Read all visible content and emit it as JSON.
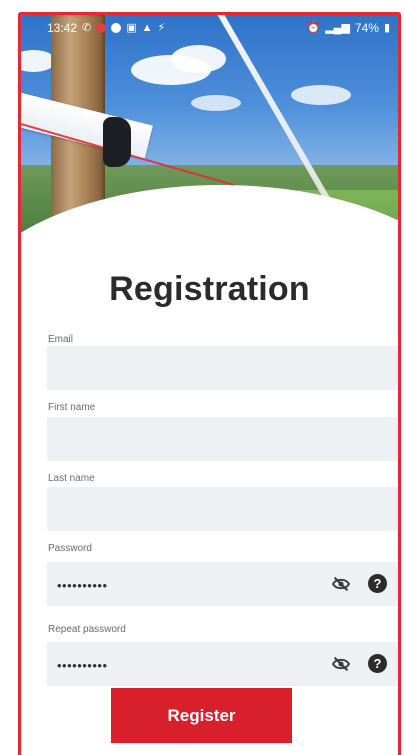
{
  "status_bar": {
    "time": "13:42",
    "battery": "74%"
  },
  "page": {
    "title": "Registration"
  },
  "form": {
    "email": {
      "label": "Email",
      "value": ""
    },
    "first_name": {
      "label": "First name",
      "value": ""
    },
    "last_name": {
      "label": "Last name",
      "value": ""
    },
    "password": {
      "label": "Password",
      "value": "••••••••••"
    },
    "repeat_password": {
      "label": "Repeat password",
      "value": "••••••••••"
    },
    "submit_label": "Register"
  },
  "colors": {
    "accent": "#d7202c",
    "frame": "#e52934",
    "field_background": "#eef0f3"
  },
  "icons": {
    "password_toggle": "eye-off-icon",
    "help": "help-circle-icon"
  }
}
